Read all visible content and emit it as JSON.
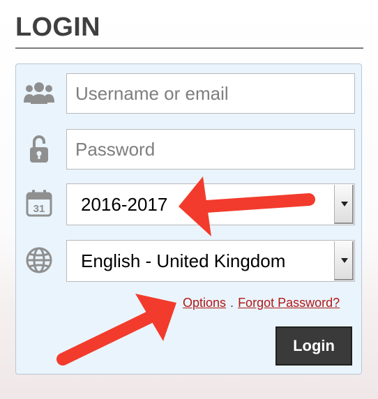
{
  "login": {
    "heading": "LOGIN",
    "username": {
      "placeholder": "Username or email",
      "value": "",
      "icon": "users-icon"
    },
    "password": {
      "placeholder": "Password",
      "value": "",
      "icon": "unlocked-padlock-icon"
    },
    "year": {
      "selected": "2016-2017",
      "icon": "calendar-icon",
      "calendar_day": "31"
    },
    "language": {
      "selected": "English - United Kingdom",
      "icon": "globe-icon"
    },
    "links": {
      "options": "Options",
      "separator": ".",
      "forgot_password": "Forgot Password?"
    },
    "submit_label": "Login"
  },
  "colors": {
    "heading": "#3f3f3f",
    "panel_background": "#eaf4fc",
    "link": "#b01818",
    "button": "#3a3a3a",
    "icon": "#8f8f8f",
    "annotation_arrow": "#f23b2c"
  }
}
